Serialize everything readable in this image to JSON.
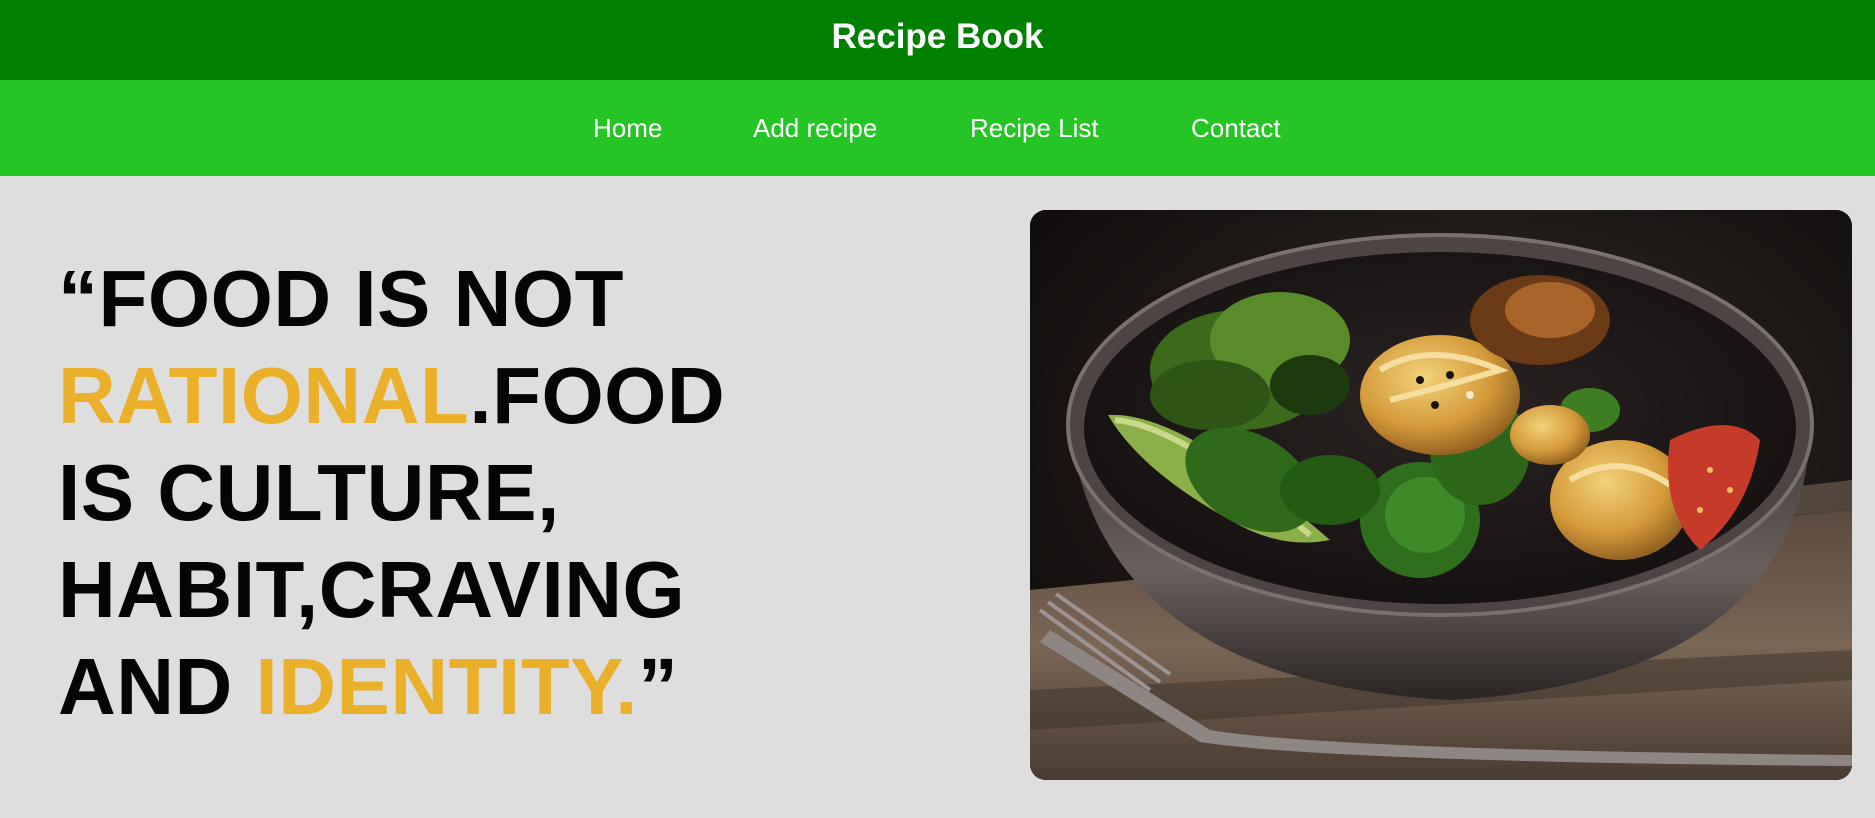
{
  "header": {
    "title": "Recipe Book"
  },
  "nav": {
    "items": [
      {
        "label": "Home"
      },
      {
        "label": "Add recipe"
      },
      {
        "label": "Recipe List"
      },
      {
        "label": "Contact"
      }
    ]
  },
  "hero": {
    "quote": {
      "line1": "“FOOD IS NOT",
      "line2_accent": "RATIONAL",
      "line2_rest": ".FOOD",
      "line3": "IS CULTURE,",
      "line4": "HABIT,CRAVING",
      "line5_start": "AND ",
      "line5_accent": "IDENTITY.",
      "line5_end": "”"
    }
  },
  "colors": {
    "header_bg": "#018001",
    "nav_bg": "#25c525",
    "page_bg": "#dedede",
    "accent": "#ebb02a",
    "text": "#050505"
  },
  "image": {
    "subject": "salad-bowl-photo"
  }
}
